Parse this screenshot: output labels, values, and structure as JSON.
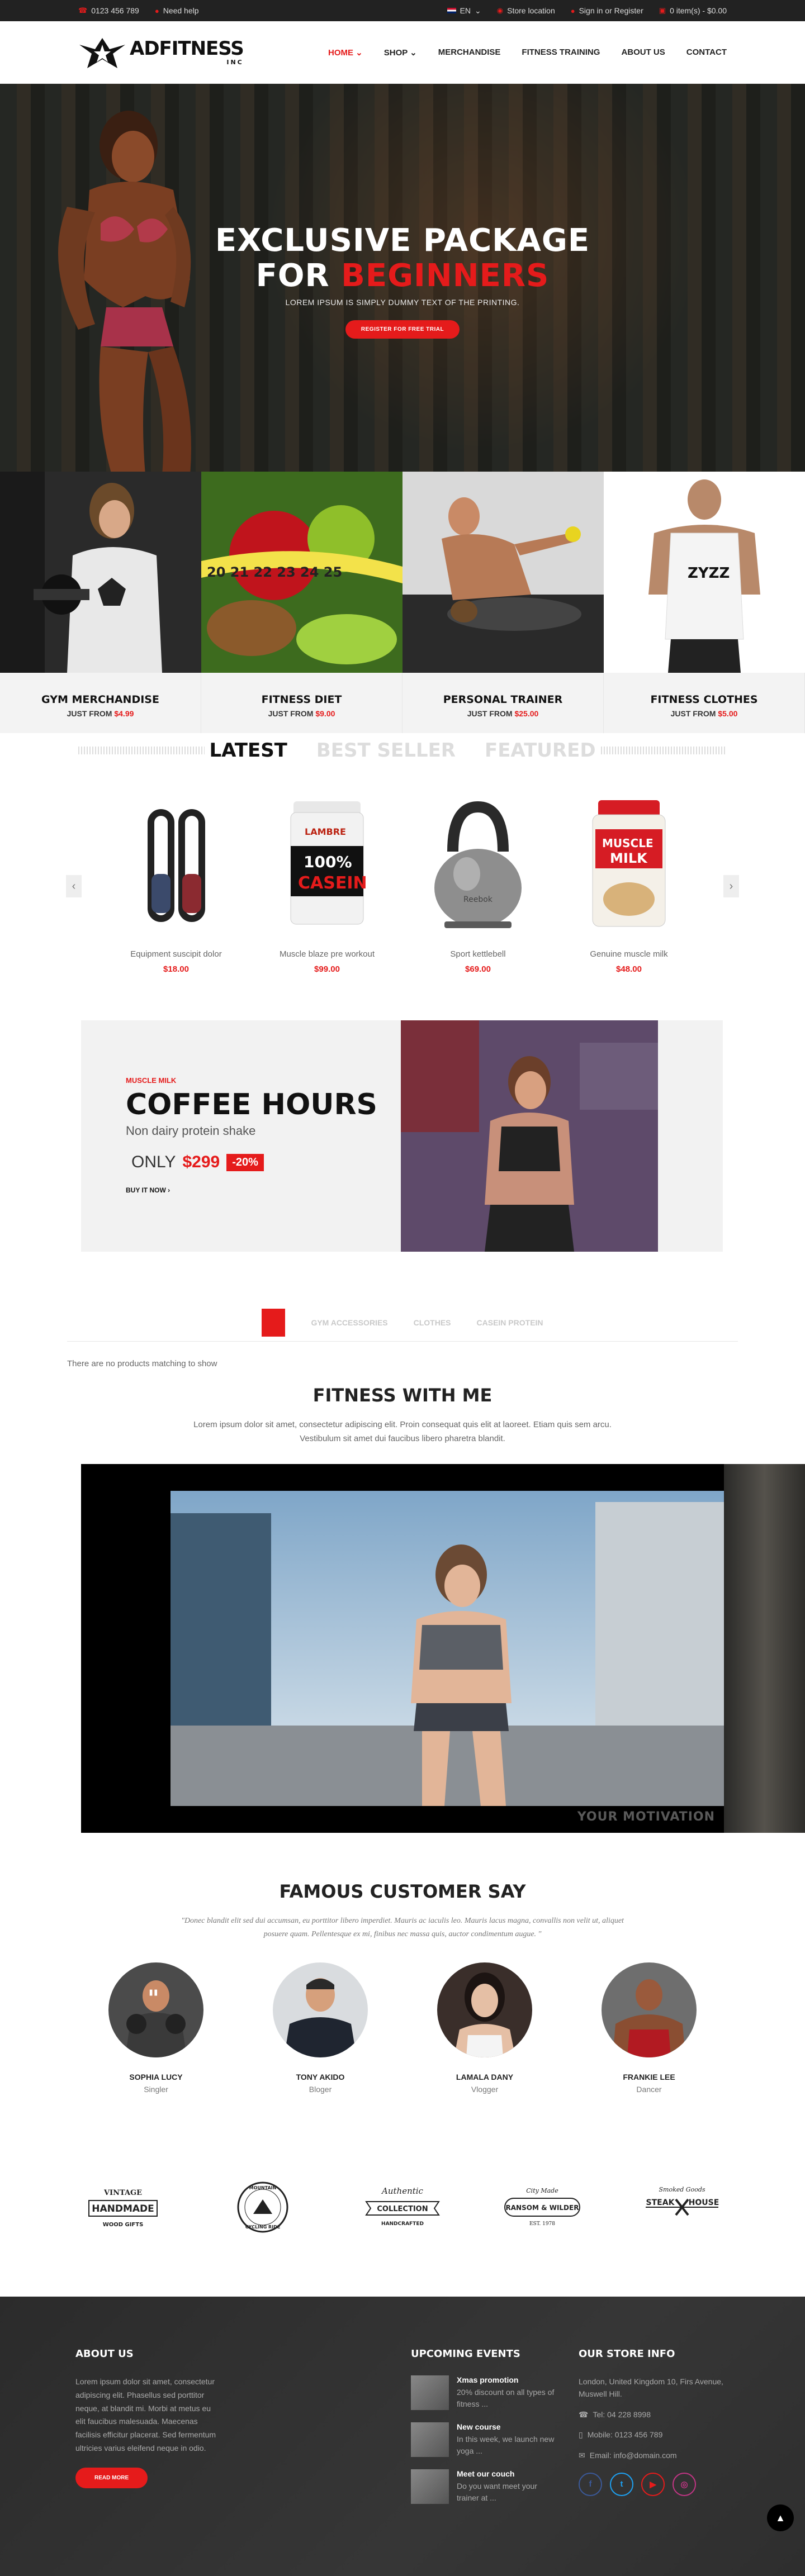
{
  "topbar": {
    "phone": "0123 456 789",
    "help": "Need help",
    "language": "EN",
    "store": "Store location",
    "signin": "Sign in or Register",
    "cart": "0 item(s) - $0.00"
  },
  "header": {
    "logo_text": "ADFITNESS",
    "logo_sub": "INC",
    "nav": [
      {
        "label": "HOME",
        "active": true,
        "dropdown": true
      },
      {
        "label": "SHOP",
        "active": false,
        "dropdown": true
      },
      {
        "label": "MERCHANDISE",
        "active": false,
        "dropdown": false
      },
      {
        "label": "FITNESS TRAINING",
        "active": false,
        "dropdown": false
      },
      {
        "label": "ABOUT US",
        "active": false,
        "dropdown": false
      },
      {
        "label": "CONTACT",
        "active": false,
        "dropdown": false
      }
    ]
  },
  "hero": {
    "line1": "EXCLUSIVE PACKAGE",
    "line2_a": "FOR",
    "line2_b": "BEGINNERS",
    "subtitle": "LOREM IPSUM IS SIMPLY DUMMY TEXT OF THE PRINTING.",
    "button": "REGISTER FOR FREE TRIAL"
  },
  "categories": [
    {
      "name": "GYM MERCHANDISE",
      "from": "JUST FROM",
      "price": "$4.99"
    },
    {
      "name": "FITNESS DIET",
      "from": "JUST FROM",
      "price": "$9.00"
    },
    {
      "name": "PERSONAL TRAINER",
      "from": "JUST FROM",
      "price": "$25.00"
    },
    {
      "name": "FITNESS CLOTHES",
      "from": "JUST FROM",
      "price": "$5.00"
    }
  ],
  "product_tabs": [
    "LATEST",
    "BEST SELLER",
    "FEATURED"
  ],
  "products": [
    {
      "name": "Equipment suscipit dolor",
      "price": "$18.00"
    },
    {
      "name": "Muscle blaze pre workout",
      "price": "$99.00"
    },
    {
      "name": "Sport kettlebell",
      "price": "$69.00"
    },
    {
      "name": "Genuine muscle milk",
      "price": "$48.00"
    }
  ],
  "product_images": {
    "casein_top": "100%",
    "casein_bottom": "CASEIN",
    "brand": "LAMBRE",
    "milk_top": "MUSCLE",
    "milk_bottom": "MILK",
    "kettle_brand": "Reebok"
  },
  "banner": {
    "kicker": "MUSCLE MILK",
    "title": "COFFEE HOURS",
    "subtitle": "Non dairy protein shake",
    "only": "ONLY",
    "price": "$299",
    "discount": "-20%",
    "buy": "BUY IT NOW"
  },
  "category_tabs": [
    "GYM ACCESSORIES",
    "CLOTHES",
    "CASEIN PROTEIN"
  ],
  "no_products": "There are no products matching to show",
  "fitness": {
    "title": "FITNESS WITH ME",
    "text": "Lorem ipsum dolor sit amet, consectetur adipiscing elit. Proin consequat quis elit at laoreet. Etiam quis sem arcu. Vestibulum sit amet dui faucibus libero pharetra blandit."
  },
  "video": {
    "watermark": "YOUR MOTIVATION"
  },
  "testimonials": {
    "title": "FAMOUS CUSTOMER SAY",
    "quote": "\"Donec blandit elit sed dui accumsan, eu porttitor libero imperdiet. Mauris ac iaculis leo. Mauris lacus magna, convallis non velit ut, aliquet posuere quam. Pellentesque ex mi, finibus nec massa quis, auctor condimentum augue. \"",
    "people": [
      {
        "name": "SOPHIA LUCY",
        "role": "Singler"
      },
      {
        "name": "TONY AKIDO",
        "role": "Bloger"
      },
      {
        "name": "LAMALA DANY",
        "role": "Vlogger"
      },
      {
        "name": "FRANKIE LEE",
        "role": "Dancer"
      }
    ]
  },
  "brands": [
    {
      "top": "VINTAGE",
      "main": "HANDMADE",
      "bottom": "WOOD GIFTS"
    },
    {
      "top": "MOUNTAIN",
      "main": "",
      "bottom": "CYCLING RIDE"
    },
    {
      "top": "Authentic",
      "main": "COLLECTION",
      "bottom": "HANDCRAFTED"
    },
    {
      "top": "City Made",
      "main": "RANSOM & WILDER",
      "bottom": "EST. 1978"
    },
    {
      "top": "Smoked Goods",
      "main": "STEAK",
      "bottom": "HOUSE"
    }
  ],
  "footer": {
    "about": {
      "title": "ABOUT US",
      "text": "Lorem ipsum dolor sit amet, consectetur adipiscing elit. Phasellus sed porttitor neque, at blandit mi. Morbi at metus eu elit faucibus malesuada. Maecenas facilisis efficitur placerat. Sed fermentum ultricies varius eleifend neque in odio.",
      "button": "READ MORE"
    },
    "events": {
      "title": "UPCOMING EVENTS",
      "items": [
        {
          "title": "Xmas promotion",
          "desc": "20% discount on all types of fitness ..."
        },
        {
          "title": "New course",
          "desc": "In this week, we launch new yoga ..."
        },
        {
          "title": "Meet our couch",
          "desc": "Do you want meet your trainer at ..."
        }
      ]
    },
    "store": {
      "title": "OUR STORE INFO",
      "address": "London, United Kingdom 10, Firs Avenue, Muswell Hill.",
      "tel": "Tel: 04 228 8998",
      "mobile": "Mobile: 0123 456 789",
      "email": "Email: info@domain.com"
    },
    "social": [
      {
        "icon": "facebook-icon",
        "glyph": "f",
        "color": "#3b5998"
      },
      {
        "icon": "twitter-icon",
        "glyph": "t",
        "color": "#1da1f2"
      },
      {
        "icon": "youtube-icon",
        "glyph": "▶",
        "color": "#e51b1b"
      },
      {
        "icon": "instagram-icon",
        "glyph": "◎",
        "color": "#c13584"
      }
    ]
  },
  "colors": {
    "accent": "#e51b1b",
    "dark": "#222222",
    "footer": "#2f2f2f"
  }
}
